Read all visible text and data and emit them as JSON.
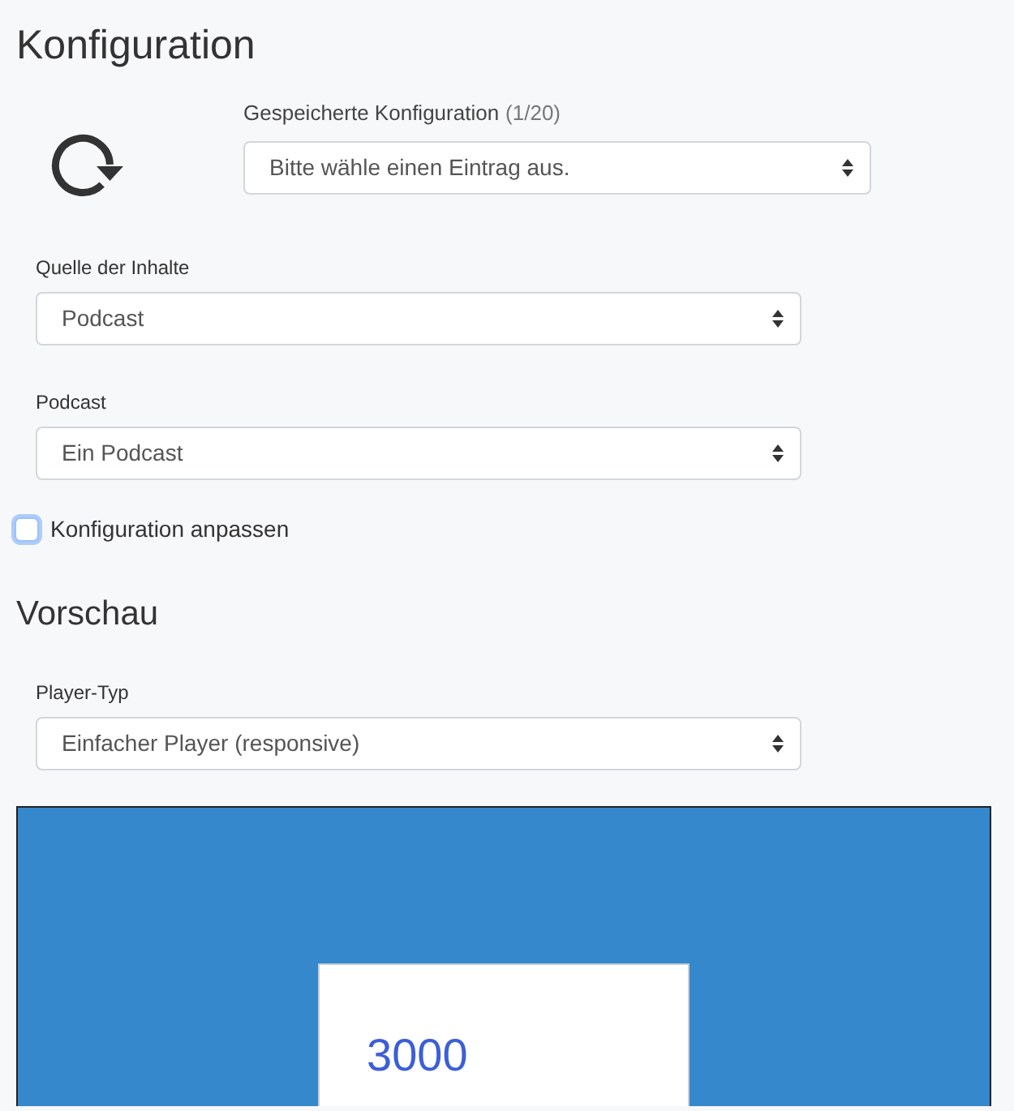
{
  "config": {
    "title": "Konfiguration",
    "saved": {
      "label": "Gespeicherte Konfiguration",
      "count": "(1/20)",
      "value": "Bitte wähle einen Eintrag aus."
    },
    "fields": [
      {
        "label": "Quelle der Inhalte",
        "value": "Podcast"
      },
      {
        "label": "Podcast",
        "value": "Ein Podcast"
      }
    ],
    "customize": {
      "label": "Konfiguration anpassen",
      "checked": false,
      "focused": true
    }
  },
  "preview": {
    "title": "Vorschau",
    "fields": [
      {
        "label": "Player-Typ",
        "value": "Einfacher Player (responsive)"
      }
    ],
    "player": {
      "value": "3000"
    }
  }
}
